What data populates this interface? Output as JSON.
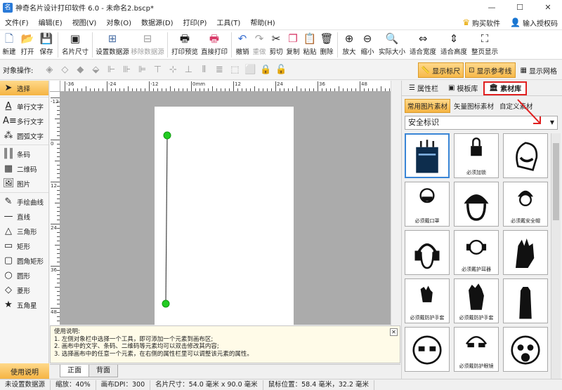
{
  "window": {
    "title": "神奇名片设计打印软件 6.0 - 未命名2.bscp*",
    "controls": [
      "—",
      "☐",
      "✕"
    ]
  },
  "menu": {
    "items": [
      "文件(F)",
      "编辑(E)",
      "视图(V)",
      "对象(O)",
      "数据源(D)",
      "打印(P)",
      "工具(T)",
      "帮助(H)"
    ],
    "buy": "购买软件",
    "auth": "输入授权码"
  },
  "toolbar": {
    "buttons": [
      {
        "label": "新建",
        "icon": "new-file-icon"
      },
      {
        "label": "打开",
        "icon": "open-folder-icon"
      },
      {
        "label": "保存",
        "icon": "save-icon"
      },
      {
        "label": "名片尺寸",
        "icon": "card-size-icon"
      },
      {
        "label": "设置数据源",
        "icon": "set-datasource-icon"
      },
      {
        "label": "移除数据源",
        "icon": "remove-datasource-icon"
      },
      {
        "label": "打印预览",
        "icon": "print-preview-icon"
      },
      {
        "label": "直接打印",
        "icon": "print-icon"
      },
      {
        "label": "撤销",
        "icon": "undo-icon"
      },
      {
        "label": "重做",
        "icon": "redo-icon"
      },
      {
        "label": "剪切",
        "icon": "cut-icon"
      },
      {
        "label": "复制",
        "icon": "copy-icon"
      },
      {
        "label": "粘贴",
        "icon": "paste-icon"
      },
      {
        "label": "删除",
        "icon": "delete-icon"
      },
      {
        "label": "放大",
        "icon": "zoom-in-icon"
      },
      {
        "label": "缩小",
        "icon": "zoom-out-icon"
      },
      {
        "label": "实际大小",
        "icon": "actual-size-icon"
      },
      {
        "label": "适合宽度",
        "icon": "fit-width-icon"
      },
      {
        "label": "适合高度",
        "icon": "fit-height-icon"
      },
      {
        "label": "整页显示",
        "icon": "fit-page-icon"
      }
    ]
  },
  "ops": {
    "label": "对象操作:",
    "show_ruler": "显示标尺",
    "show_guides": "显示参考线",
    "show_grid": "显示网格"
  },
  "tools": [
    "选择",
    "单行文字",
    "多行文字",
    "圆弧文字",
    "条码",
    "二维码",
    "图片",
    "手绘曲线",
    "直线",
    "三角形",
    "矩形",
    "圆角矩形",
    "圆形",
    "菱形",
    "五角星"
  ],
  "help_button": "使用说明",
  "ruler": {
    "h_labels": [
      "-36",
      "-24",
      "-12",
      "0mm",
      "12",
      "24",
      "36",
      "48",
      "60"
    ],
    "v_labels": [
      "-12",
      "0",
      "12",
      "24",
      "36",
      "48",
      "60",
      "72",
      "84"
    ]
  },
  "help": {
    "title": "使用说明:",
    "lines": [
      "1. 左侧对象栏中选择一个工具，即可添加一个元素到画布区;",
      "2. 画布中的文字、条码、二维码等元素均可以双击修改其内容;",
      "3. 选择画布中的任意一个元素，在右侧的属性栏里可以调整该元素的属性。"
    ]
  },
  "page_tabs": [
    "正面",
    "背面"
  ],
  "right_panel": {
    "tabs": [
      "属性栏",
      "模板库",
      "素材库"
    ],
    "subtabs": [
      "常用图片素材",
      "矢量图标素材",
      "自定义素材"
    ],
    "category": "安全标识",
    "items": [
      {
        "label": ""
      },
      {
        "label": "必须加锁"
      },
      {
        "label": ""
      },
      {
        "label": "必须戴口罩"
      },
      {
        "label": ""
      },
      {
        "label": "必须戴安全帽"
      },
      {
        "label": ""
      },
      {
        "label": "必须戴护耳器"
      },
      {
        "label": ""
      },
      {
        "label": "必须戴防护手套"
      },
      {
        "label": "必须戴防护手套"
      },
      {
        "label": ""
      },
      {
        "label": ""
      },
      {
        "label": "必须戴防护眼镜"
      },
      {
        "label": ""
      }
    ]
  },
  "status": {
    "datasource": "未设置数据源",
    "zoom": "缩放：40%",
    "dpi": "画布DPI：300",
    "card_size": "名片尺寸：54.0 毫米 x 90.0 毫米",
    "mouse_pos": "鼠标位置：58.4 毫米，32.2 毫米"
  },
  "colors": {
    "accent_orange": "#f5b443",
    "selection_red": "#e02020",
    "canvas_bg": "#ababab",
    "handle_green": "#22cc22"
  }
}
